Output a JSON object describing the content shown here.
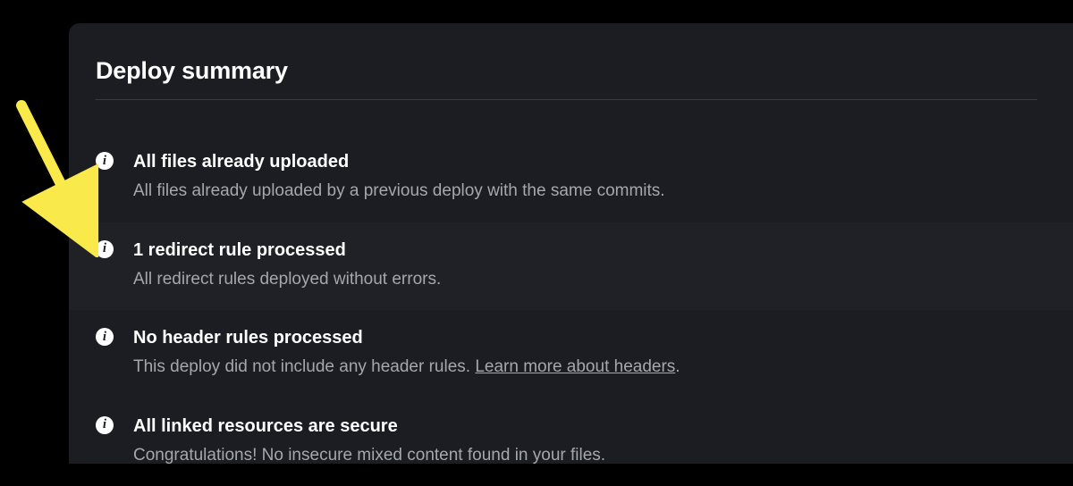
{
  "section": {
    "title": "Deploy summary"
  },
  "items": [
    {
      "title": "All files already uploaded",
      "description": "All files already uploaded by a previous deploy with the same commits.",
      "highlighted": false
    },
    {
      "title": "1 redirect rule processed",
      "description": "All redirect rules deployed without errors.",
      "highlighted": true
    },
    {
      "title": "No header rules processed",
      "description": "This deploy did not include any header rules. ",
      "link_text": "Learn more about headers",
      "link_suffix": ".",
      "highlighted": false
    },
    {
      "title": "All linked resources are secure",
      "description": "Congratulations! No insecure mixed content found in your files.",
      "highlighted": false
    }
  ],
  "annotation": {
    "arrow_color": "#f9e94a"
  }
}
